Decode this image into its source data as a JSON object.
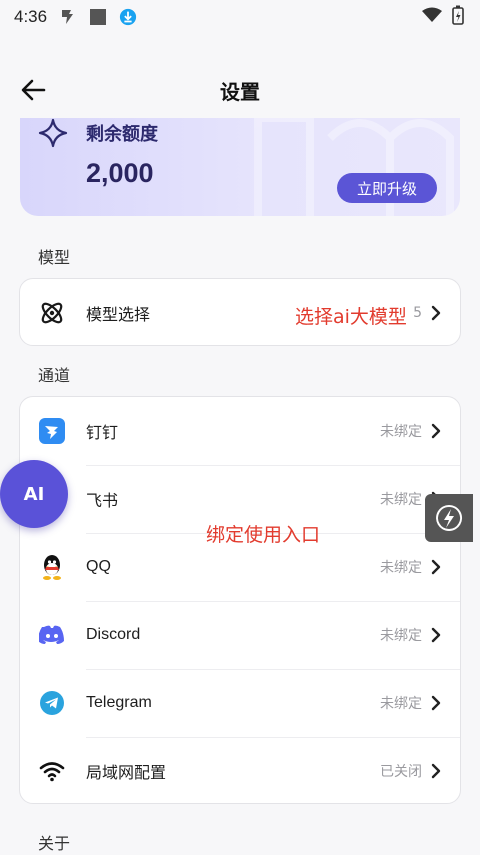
{
  "status_bar": {
    "time": "4:36",
    "icons": [
      "notification-icon",
      "square-icon",
      "download-icon",
      "wifi-icon",
      "battery-icon"
    ]
  },
  "header": {
    "title": "设置",
    "back_icon": "arrow-left-icon"
  },
  "quota": {
    "label": "剩余额度",
    "value": "2,000",
    "upgrade_label": "立即升级",
    "icon": "sparkle-icon",
    "accent": "#5b55d6"
  },
  "sections": {
    "model": "模型",
    "channel": "通道",
    "about": "关于"
  },
  "model_row": {
    "label": "模型选择",
    "value_fragment": "5",
    "icon": "atom-icon"
  },
  "channels": [
    {
      "label": "钉钉",
      "status": "未绑定",
      "icon": "dingtalk-icon"
    },
    {
      "label": "飞书",
      "status": "未绑定",
      "icon": "feishu-icon"
    },
    {
      "label": "QQ",
      "status": "未绑定",
      "icon": "qq-icon"
    },
    {
      "label": "Discord",
      "status": "未绑定",
      "icon": "discord-icon"
    },
    {
      "label": "Telegram",
      "status": "未绑定",
      "icon": "telegram-icon"
    },
    {
      "label": "局域网配置",
      "status": "已关闭",
      "icon": "wifi-icon"
    }
  ],
  "annotations": {
    "model": "选择ai大模型",
    "channels": "绑定使用入口"
  },
  "fab": {
    "label": "AI"
  },
  "colors": {
    "annotation": "#e23b2e",
    "fab": "#5a52d8",
    "status_text": "#9a9a9f"
  }
}
